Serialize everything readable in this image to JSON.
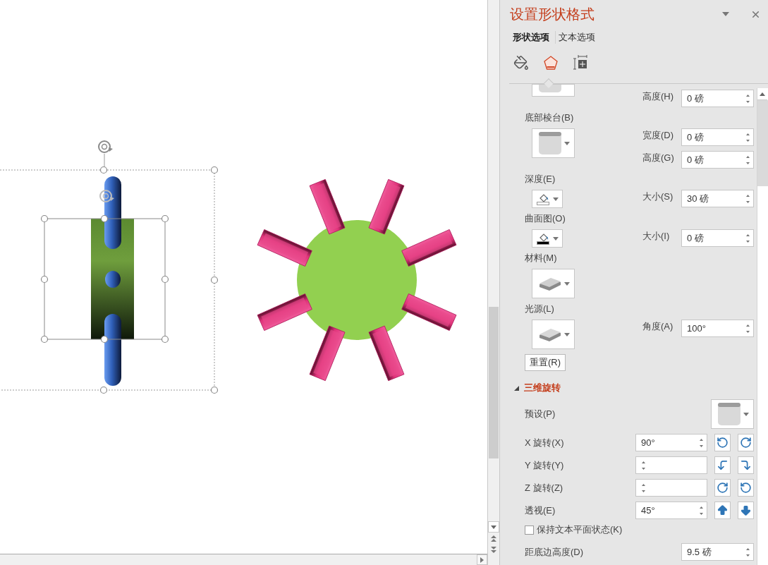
{
  "panel": {
    "title": "设置形状格式",
    "tabs": [
      {
        "label": "形状选项",
        "selected": true
      },
      {
        "label": "文本选项",
        "selected": false
      }
    ],
    "icon_tabs": [
      {
        "kind": "fill",
        "selected": false
      },
      {
        "kind": "effects",
        "selected": true
      },
      {
        "kind": "layout",
        "selected": false
      }
    ],
    "sections": [
      {
        "kind": "bevel",
        "fields": [
          {
            "label": "高度(H)",
            "value": "0 磅"
          }
        ]
      },
      {
        "kind": "bevel",
        "label": "底部棱台(B)",
        "fields": [
          {
            "label": "宽度(D)",
            "value": "0 磅"
          },
          {
            "label": "高度(G)",
            "value": "0 磅"
          }
        ]
      },
      {
        "kind": "color",
        "label": "深度(E)",
        "color": "#ffffff",
        "fields": [
          {
            "label": "大小(S)",
            "value": "30 磅"
          }
        ]
      },
      {
        "kind": "color",
        "label": "曲面图(O)",
        "color": "#000000",
        "fields": [
          {
            "label": "大小(I)",
            "value": "0 磅"
          }
        ]
      },
      {
        "kind": "material",
        "label": "材料(M)"
      },
      {
        "kind": "lighting",
        "label": "光源(L)",
        "fields": [
          {
            "label": "角度(A)",
            "value": "100°"
          }
        ]
      }
    ],
    "reset_button": "重置(R)",
    "rotation": {
      "title": "三维旋转",
      "expanded": true,
      "preset_label": "预设(P)",
      "axes": [
        {
          "kind": "x",
          "label": "X 旋转(X)",
          "value": "90°"
        },
        {
          "kind": "y",
          "label": "Y 旋转(Y)"
        },
        {
          "kind": "z",
          "label": "Z 旋转(Z)"
        },
        {
          "kind": "perspective",
          "label": "透视(E)",
          "value": "45°"
        }
      ],
      "keep_text_flat": {
        "label": "保持文本平面状态(K)",
        "checked": false
      },
      "distance": {
        "label": "距底边高度(D)",
        "value": "9.5 磅"
      }
    }
  }
}
